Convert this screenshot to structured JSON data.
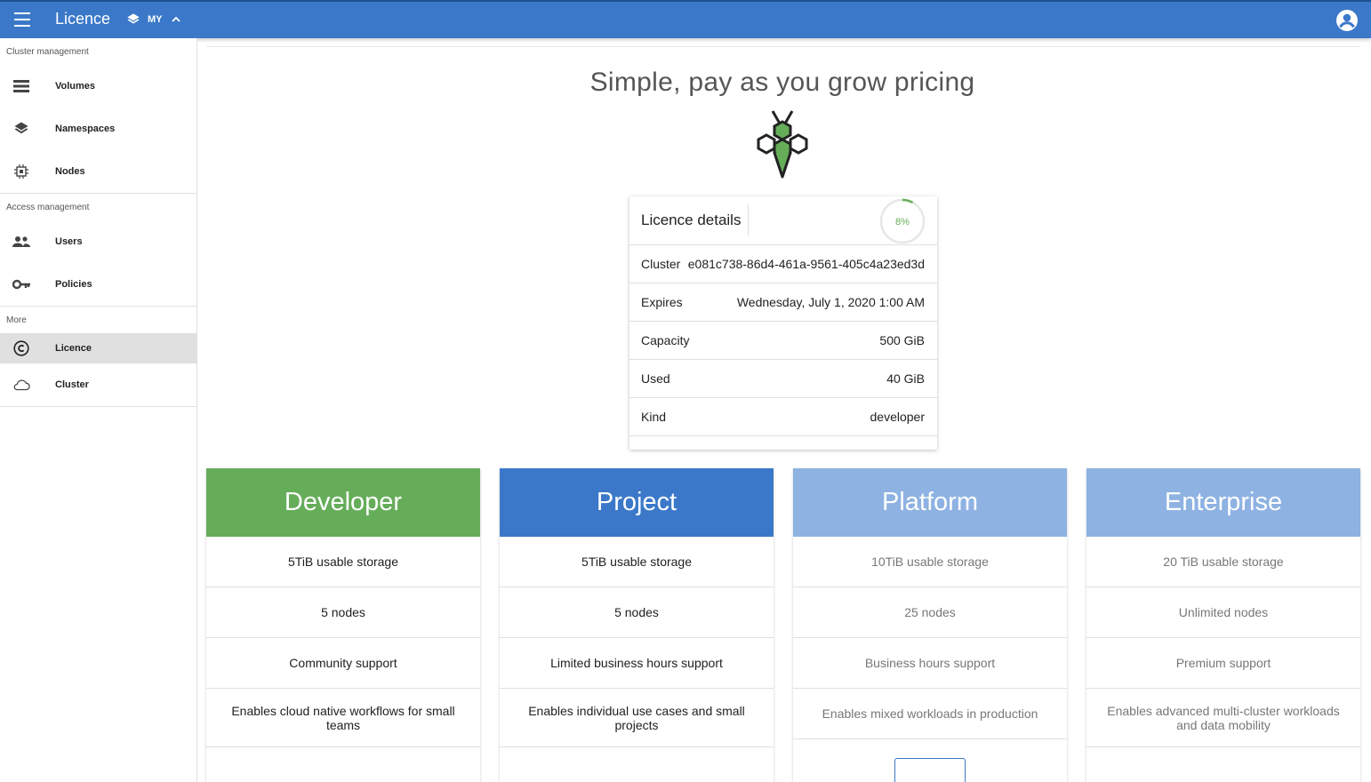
{
  "appbar": {
    "title": "Licence",
    "namespace": "MY"
  },
  "sidebar": {
    "sections": [
      {
        "title": "Cluster management",
        "items": [
          {
            "label": "Volumes",
            "icon": "list-icon"
          },
          {
            "label": "Namespaces",
            "icon": "layers-icon"
          },
          {
            "label": "Nodes",
            "icon": "chip-icon"
          }
        ]
      },
      {
        "title": "Access management",
        "items": [
          {
            "label": "Users",
            "icon": "users-icon"
          },
          {
            "label": "Policies",
            "icon": "key-icon"
          }
        ]
      },
      {
        "title": "More",
        "items": [
          {
            "label": "Licence",
            "icon": "copyright-icon",
            "active": true
          },
          {
            "label": "Cluster",
            "icon": "cloud-icon"
          }
        ]
      }
    ]
  },
  "main": {
    "headline": "Simple, pay as you grow pricing",
    "licence": {
      "title": "Licence details",
      "usage_percent": 8,
      "usage_label": "8%",
      "rows": [
        {
          "key": "Cluster",
          "value": "e081c738-86d4-461a-9561-405c4a23ed3d"
        },
        {
          "key": "Expires",
          "value": "Wednesday, July 1, 2020 1:00 AM"
        },
        {
          "key": "Capacity",
          "value": "500 GiB"
        },
        {
          "key": "Used",
          "value": "40 GiB"
        },
        {
          "key": "Kind",
          "value": "developer"
        }
      ]
    },
    "plans": [
      {
        "name": "Developer",
        "color": "#66ad5a",
        "features": [
          "5TiB usable storage",
          "5 nodes",
          "Community support",
          "Enables cloud native workflows for small teams"
        ]
      },
      {
        "name": "Project",
        "color": "#3b78c9",
        "features": [
          "5TiB usable storage",
          "5 nodes",
          "Limited business hours support",
          "Enables individual use cases and small projects"
        ]
      },
      {
        "name": "Platform",
        "color": "#8eb2e2",
        "features": [
          "10TiB usable storage",
          "25 nodes",
          "Business hours support",
          "Enables mixed workloads in production"
        ]
      },
      {
        "name": "Enterprise",
        "color": "#8eb2e2",
        "features": [
          "20 TiB usable storage",
          "Unlimited nodes",
          "Premium support",
          "Enables advanced multi-cluster workloads and data mobility"
        ]
      }
    ]
  },
  "colors": {
    "appbar": "#3b78c9",
    "accent_green": "#66ad5a"
  }
}
